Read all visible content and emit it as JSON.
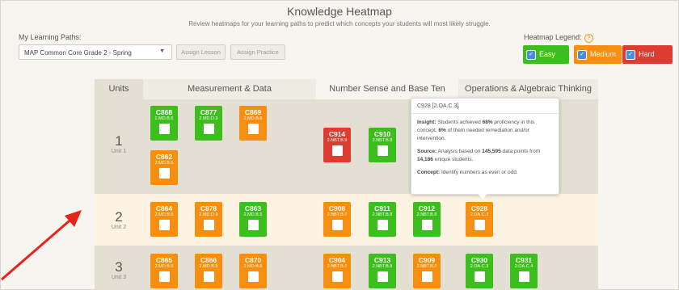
{
  "header": {
    "title": "Knowledge Heatmap",
    "subtitle": "Review heatmaps for your learning paths to predict which concepts your students will most likely struggle."
  },
  "paths": {
    "label": "My Learning Paths:",
    "selected": "MAP Common Core Grade 2 - Spring",
    "assign_lesson": "Assign Lesson",
    "assign_practice": "Assign Practice"
  },
  "legend": {
    "label": "Heatmap Legend:",
    "help": "?",
    "easy": "Easy",
    "medium": "Medium",
    "hard": "Hard"
  },
  "columns": {
    "units": "Units",
    "measure": "Measurement & Data",
    "number": "Number Sense and Base Ten",
    "ops": "Operations & Algebraic Thinking"
  },
  "units": [
    {
      "num": "1",
      "name": "Unit 1"
    },
    {
      "num": "2",
      "name": "Unit 2"
    },
    {
      "num": "3",
      "name": "Unit 3"
    }
  ],
  "tiles": {
    "c868": {
      "code": "C868",
      "std": "2.MD.B.6"
    },
    "c877": {
      "code": "C877",
      "std": "2.MD.D.9"
    },
    "c869": {
      "code": "C869",
      "std": "2.MD.B.6"
    },
    "c862": {
      "code": "C862",
      "std": "2.MD.B.5"
    },
    "c914": {
      "code": "C914",
      "std": "2.NBT.B.9"
    },
    "c910": {
      "code": "C910",
      "std": "2.NBT.B.8"
    },
    "c864": {
      "code": "C864",
      "std": "2.MD.B.5"
    },
    "c878": {
      "code": "C878",
      "std": "2.MD.D.9"
    },
    "c863": {
      "code": "C863",
      "std": "2.MD.B.5"
    },
    "c908": {
      "code": "C908",
      "std": "2.NBT.B.7"
    },
    "c911": {
      "code": "C911",
      "std": "2.NBT.B.8"
    },
    "c912": {
      "code": "C912",
      "std": "2.NBT.B.8"
    },
    "c928": {
      "code": "C928",
      "std": "2.OA.C.3"
    },
    "c865": {
      "code": "C865",
      "std": "2.MD.B.5"
    },
    "c866": {
      "code": "C866",
      "std": "2.MD.B.5"
    },
    "c870": {
      "code": "C870",
      "std": "2.MD.B.6"
    },
    "c904": {
      "code": "C904",
      "std": "2.NBT.B.7"
    },
    "c913": {
      "code": "C913",
      "std": "2.NBT.B.8"
    },
    "c909": {
      "code": "C909",
      "std": "2.NBT.B.7"
    },
    "c930": {
      "code": "C930",
      "std": "2.OA.C.3"
    },
    "c931": {
      "code": "C931",
      "std": "2.OA.C.4"
    }
  },
  "tooltip": {
    "title": "C928 [2.OA.C.3]",
    "insight_label": "Insight:",
    "insight_pre": "Students achieved",
    "insight_pct": "68%",
    "insight_mid": "proficiency in this concept.",
    "remed_pct": "6%",
    "remed_text": "of them needed remediation and/or intervention.",
    "source_label": "Source:",
    "source_pre": "Analysis based on",
    "points": "145,595",
    "source_mid": "data points from",
    "students": "14,186",
    "source_post": "unique students.",
    "concept_label": "Concept:",
    "concept_text": "Identify numbers as even or odd."
  },
  "colors": {
    "easy": "#3cbe1d",
    "medium": "#f68e0f",
    "hard": "#dd3d30",
    "annotation": "#e8231c"
  }
}
